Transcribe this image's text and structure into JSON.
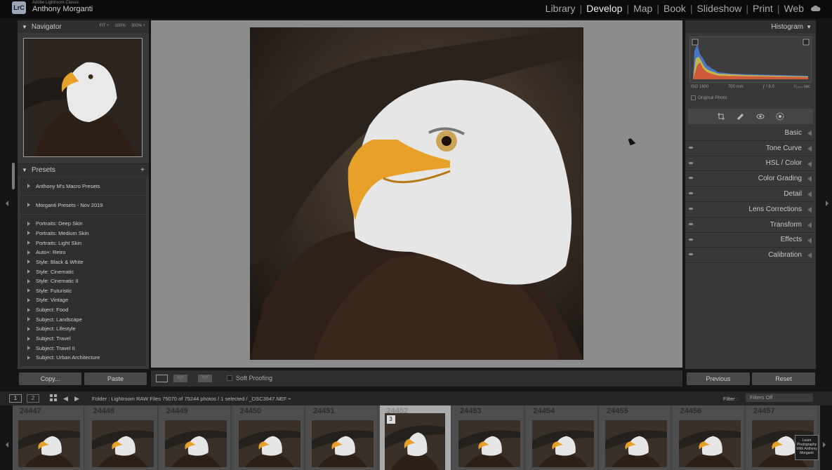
{
  "app": {
    "logo": "LrC",
    "catalog": "Adobe Lightroom Classic",
    "user": "Anthony Morganti"
  },
  "modules": [
    "Library",
    "Develop",
    "Map",
    "Book",
    "Slideshow",
    "Print",
    "Web"
  ],
  "active_module": "Develop",
  "navigator": {
    "title": "Navigator",
    "zoom": [
      "FIT ÷",
      "100%",
      "300% ÷"
    ]
  },
  "presets": {
    "title": "Presets",
    "add": "+",
    "groups": [
      "Anthony M's Macro Presets",
      "Morganti Presets - Nov 2019"
    ],
    "items": [
      "Portraits: Deep Skin",
      "Portraits: Medium Skin",
      "Portraits: Light Skin",
      "Auto+: Retro",
      "Style: Black & White",
      "Style: Cinematic",
      "Style: Cinematic II",
      "Style: Futuristic",
      "Style: Vintage",
      "Subject: Food",
      "Subject: Landscape",
      "Subject: Lifestyle",
      "Subject: Travel",
      "Subject: Travel II",
      "Subject: Urban Architecture"
    ]
  },
  "left_buttons": {
    "copy": "Copy...",
    "paste": "Paste"
  },
  "toolbar": {
    "compare": "X|Y",
    "survey": "Y|Y",
    "soft_proofing": "Soft Proofing"
  },
  "histogram": {
    "title": "Histogram",
    "iso": "ISO 1600",
    "focal": "700 mm",
    "aperture": "ƒ / 8.0",
    "shutter": "¹⁄₁₀₀₀ sec",
    "original_photo": "Original Photo"
  },
  "sections": [
    "Basic",
    "Tone Curve",
    "HSL / Color",
    "Color Grading",
    "Detail",
    "Lens Corrections",
    "Transform",
    "Effects",
    "Calibration"
  ],
  "right_buttons": {
    "previous": "Previous",
    "reset": "Reset"
  },
  "filmbar": {
    "page1": "1",
    "page2": "2",
    "folder": "Folder : Lightroom RAW Files     75070 of 75244 photos / 1 selected / _DSC3947.NEF ÷",
    "filter_label": "Filter :",
    "filter_value": "Filters Off"
  },
  "filmstrip": {
    "numbers": [
      "24447",
      "24448",
      "24449",
      "24450",
      "24451",
      "24452",
      "24453",
      "24454",
      "24455",
      "24456",
      "24457"
    ],
    "selected_index": 5,
    "selected_badge": "3"
  },
  "watermark": "Learn Photography With Anthony Morganti",
  "colors": {
    "accent": "#e8a128",
    "panel": "#383838",
    "canvas": "#8c8c8c"
  }
}
